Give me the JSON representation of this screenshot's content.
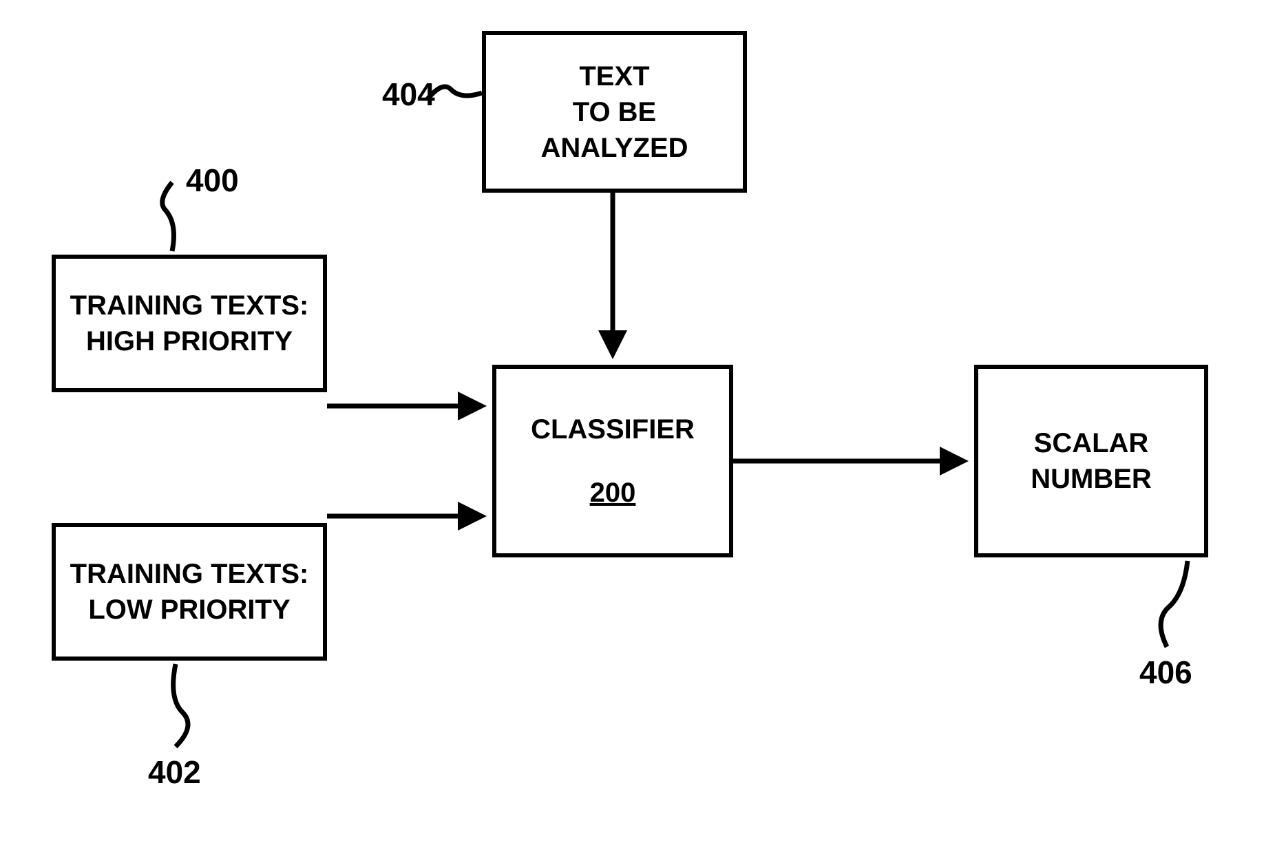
{
  "boxes": {
    "highPriority": {
      "line1": "TRAINING TEXTS:",
      "line2": "HIGH PRIORITY",
      "ref": "400"
    },
    "lowPriority": {
      "line1": "TRAINING TEXTS:",
      "line2": "LOW PRIORITY",
      "ref": "402"
    },
    "textAnalyzed": {
      "line1": "TEXT",
      "line2": "TO BE",
      "line3": "ANALYZED",
      "ref": "404"
    },
    "classifier": {
      "label": "CLASSIFIER",
      "id": "200"
    },
    "scalar": {
      "line1": "SCALAR",
      "line2": "NUMBER",
      "ref": "406"
    }
  }
}
